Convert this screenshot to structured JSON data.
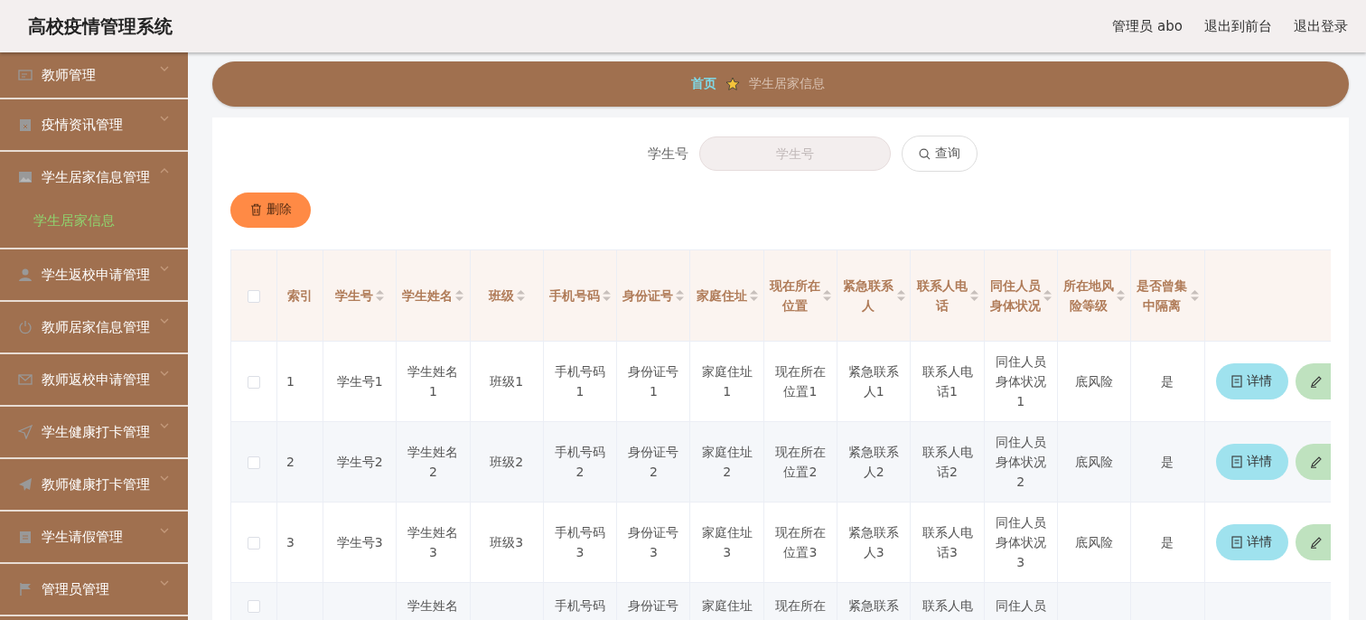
{
  "header": {
    "title": "高校疫情管理系统",
    "links": [
      "管理员 abo",
      "退出到前台",
      "退出登录"
    ]
  },
  "sidebar": {
    "items": [
      {
        "label": "教师管理",
        "expanded": false
      },
      {
        "label": "疫情资讯管理",
        "expanded": false
      },
      {
        "label": "学生居家信息管理",
        "expanded": true,
        "children": [
          {
            "label": "学生居家信息",
            "selected": true
          }
        ]
      },
      {
        "label": "学生返校申请管理",
        "expanded": false
      },
      {
        "label": "教师居家信息管理",
        "expanded": false
      },
      {
        "label": "教师返校申请管理",
        "expanded": false
      },
      {
        "label": "学生健康打卡管理",
        "expanded": false
      },
      {
        "label": "教师健康打卡管理",
        "expanded": false
      },
      {
        "label": "学生请假管理",
        "expanded": false
      },
      {
        "label": "管理员管理",
        "expanded": false
      }
    ]
  },
  "breadcrumb": [
    "首页",
    "学生居家信息"
  ],
  "search": {
    "label": "学生号",
    "placeholder": "学生号",
    "button": "查询"
  },
  "delete_button": "删除",
  "table": {
    "select_all": {
      "checked": false
    },
    "columns": [
      {
        "label": "索引",
        "sortable": false
      },
      {
        "label": "学生号",
        "sortable": true
      },
      {
        "label": "学生姓名",
        "sortable": true
      },
      {
        "label": "班级",
        "sortable": true
      },
      {
        "label": "手机号码",
        "sortable": true
      },
      {
        "label": "身份证号",
        "sortable": true
      },
      {
        "label": "家庭住址",
        "sortable": true
      },
      {
        "label": "现在所在位置",
        "sortable": true
      },
      {
        "label": "紧急联系人",
        "sortable": true
      },
      {
        "label": "联系人电话",
        "sortable": true
      },
      {
        "label": "同住人员身体状况",
        "sortable": true
      },
      {
        "label": "所在地风险等级",
        "sortable": true
      },
      {
        "label": "是否曾集中隔离",
        "sortable": true
      }
    ],
    "rows": [
      {
        "checked": false,
        "cells": [
          "1",
          "学生号1",
          "学生姓名1",
          "班级1",
          "手机号码1",
          "身份证号1",
          "家庭住址1",
          "现在所在位置1",
          "紧急联系人1",
          "联系人电话1",
          "同住人员身体状况1",
          "底风险",
          "是"
        ],
        "detail_button": "详情"
      },
      {
        "checked": false,
        "cells": [
          "2",
          "学生号2",
          "学生姓名2",
          "班级2",
          "手机号码2",
          "身份证号2",
          "家庭住址2",
          "现在所在位置2",
          "紧急联系人2",
          "联系人电话2",
          "同住人员身体状况2",
          "底风险",
          "是"
        ],
        "detail_button": "详情"
      },
      {
        "checked": false,
        "cells": [
          "3",
          "学生号3",
          "学生姓名3",
          "班级3",
          "手机号码3",
          "身份证号3",
          "家庭住址3",
          "现在所在位置3",
          "紧急联系人3",
          "联系人电话3",
          "同住人员身体状况3",
          "底风险",
          "是"
        ],
        "detail_button": "详情"
      },
      {
        "checked": false,
        "cells": [
          null,
          null,
          "学生姓名",
          null,
          "手机号码",
          "身份证号",
          "家庭住址",
          "现在所在",
          "紧急联系",
          "联系人电",
          "同住人员",
          null,
          null
        ]
      }
    ]
  }
}
